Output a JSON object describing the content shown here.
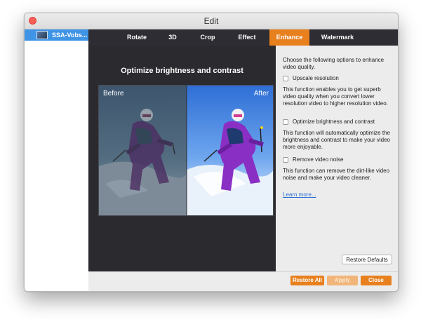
{
  "window": {
    "title": "Edit"
  },
  "sidebar": {
    "items": [
      {
        "label": "SSA-Vobs..."
      }
    ]
  },
  "tabs": [
    {
      "label": "Rotate"
    },
    {
      "label": "3D"
    },
    {
      "label": "Crop"
    },
    {
      "label": "Effect"
    },
    {
      "label": "Enhance",
      "active": true
    },
    {
      "label": "Watermark"
    }
  ],
  "preview": {
    "title": "Optimize brightness and contrast",
    "before_label": "Before",
    "after_label": "After"
  },
  "panel": {
    "intro": "Choose the following options to enhance video quality.",
    "options": [
      {
        "label": "Upscale resolution",
        "checked": false,
        "description": "This function enables you to get superb video quality when you convert lower resolution video to higher resolution video."
      },
      {
        "label": "Optimize brightness and contrast",
        "checked": false,
        "description": "This function will automatically optimize the brightness and contrast to make your video more enjoyable."
      },
      {
        "label": "Remove video noise",
        "checked": false,
        "description": "This function can remove the dirt-like video noise and make your video cleaner."
      }
    ],
    "learn_more": "Learn more...",
    "restore_defaults": "Restore Defaults"
  },
  "footer": {
    "restore_all": "Restore All",
    "apply": "Apply",
    "close": "Close"
  },
  "colors": {
    "accent": "#e8801e",
    "dark_bg": "#2d2d33",
    "selection": "#3f94e6"
  }
}
